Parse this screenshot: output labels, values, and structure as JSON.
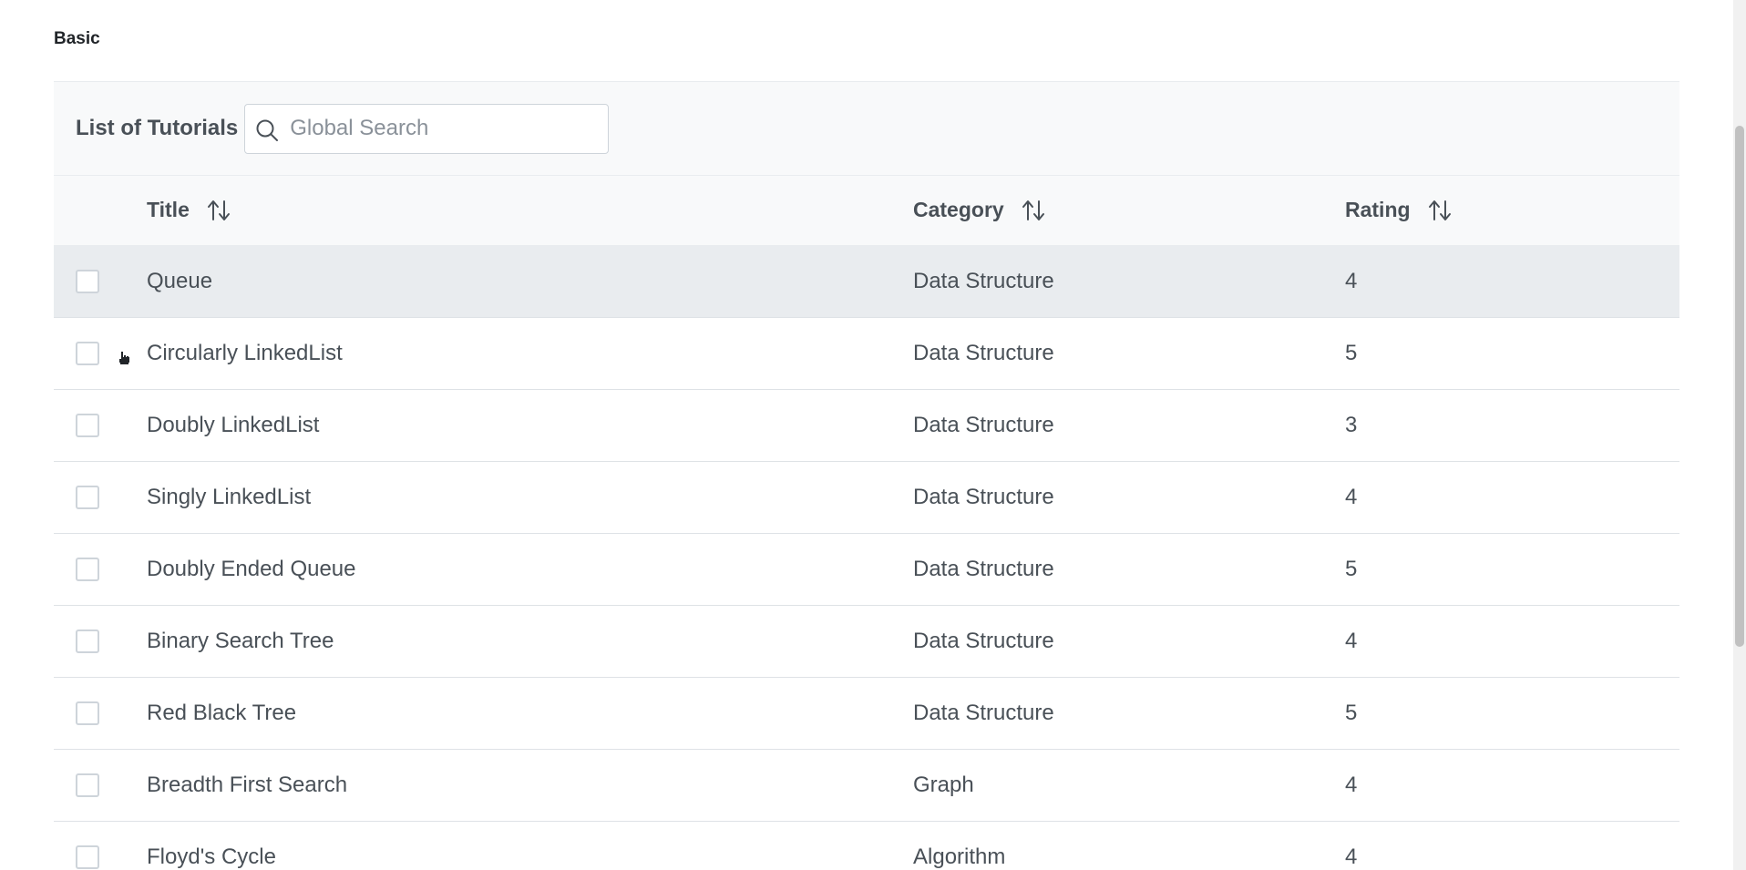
{
  "section": {
    "title": "Basic"
  },
  "table": {
    "caption": "List of Tutorials",
    "search": {
      "placeholder": "Global Search",
      "value": ""
    },
    "columns": [
      "Title",
      "Category",
      "Rating"
    ],
    "rows": [
      {
        "title": "Queue",
        "category": "Data Structure",
        "rating": "4",
        "selected": true
      },
      {
        "title": "Circularly LinkedList",
        "category": "Data Structure",
        "rating": "5"
      },
      {
        "title": "Doubly LinkedList",
        "category": "Data Structure",
        "rating": "3"
      },
      {
        "title": "Singly LinkedList",
        "category": "Data Structure",
        "rating": "4"
      },
      {
        "title": "Doubly Ended Queue",
        "category": "Data Structure",
        "rating": "5"
      },
      {
        "title": "Binary Search Tree",
        "category": "Data Structure",
        "rating": "4"
      },
      {
        "title": "Red Black Tree",
        "category": "Data Structure",
        "rating": "5"
      },
      {
        "title": "Breadth First Search",
        "category": "Graph",
        "rating": "4"
      },
      {
        "title": "Floyd's Cycle",
        "category": "Algorithm",
        "rating": "4"
      }
    ]
  },
  "icons": {
    "search": "search-icon",
    "sort": "sort-alt-icon",
    "drag": "drag-handle-icon"
  },
  "colors": {
    "header_bg": "#f8f9fa",
    "selected_row_bg": "#e9ecef",
    "text": "#495057",
    "border": "#dee2e6"
  }
}
